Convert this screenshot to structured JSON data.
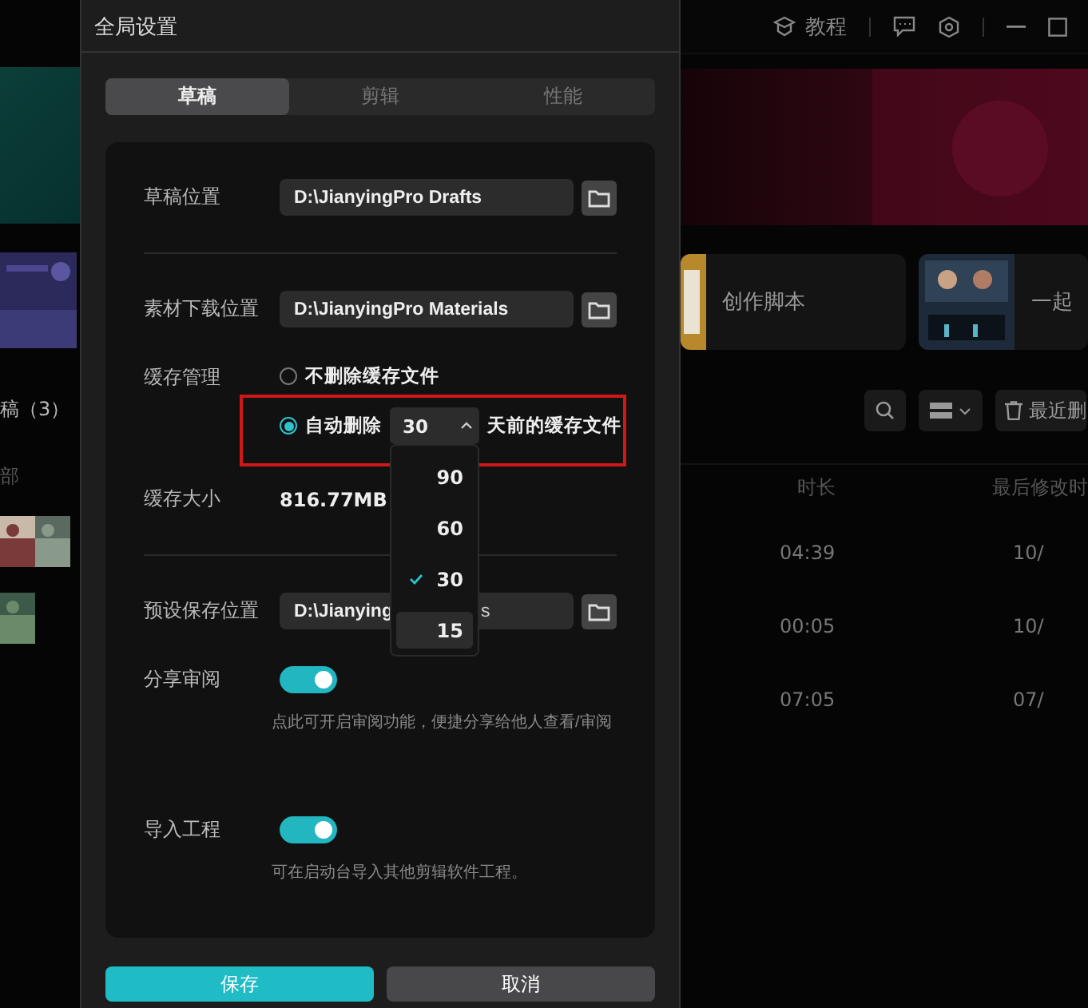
{
  "background_app": {
    "tutorial_label": "教程",
    "cards": [
      {
        "title": "创作脚本"
      },
      {
        "title": "一起"
      }
    ],
    "drafts_title": "稿（3）",
    "recent_deleted": "最近删",
    "columns": [
      "部",
      "时长",
      "最后修改时"
    ],
    "rows": [
      {
        "duration": "04:39",
        "modified": "10/"
      },
      {
        "duration": "00:05",
        "modified": "10/"
      },
      {
        "duration": "07:05",
        "modified": "07/"
      }
    ]
  },
  "dialog": {
    "title": "全局设置",
    "tabs": [
      {
        "label": "草稿",
        "selected": true
      },
      {
        "label": "剪辑",
        "selected": false
      },
      {
        "label": "性能",
        "selected": false
      }
    ],
    "draft_location": {
      "label": "草稿位置",
      "value": "D:\\JianyingPro Drafts"
    },
    "material_location": {
      "label": "素材下载位置",
      "value": "D:\\JianyingPro Materials"
    },
    "cache": {
      "label": "缓存管理",
      "options": [
        {
          "kind": "keep",
          "label": "不删除缓存文件",
          "selected": false
        },
        {
          "kind": "auto",
          "label_before": "自动删除",
          "days": "30",
          "label_after": "天前的缓存文件",
          "selected": true
        }
      ],
      "days_menu": [
        {
          "label": "90",
          "checked": false,
          "hovered": false
        },
        {
          "label": "60",
          "checked": false,
          "hovered": false
        },
        {
          "label": "30",
          "checked": true,
          "hovered": false
        },
        {
          "label": "15",
          "checked": false,
          "hovered": true
        }
      ]
    },
    "cache_size": {
      "label": "缓存大小",
      "value": "816.77MB"
    },
    "preset_location": {
      "label": "预设保存位置",
      "value_start": "D:\\Jianying",
      "value_end": "s"
    },
    "share_review": {
      "label": "分享审阅",
      "on": true,
      "description": "点此可开启审阅功能，便捷分享给他人查看/审阅"
    },
    "import_project": {
      "label": "导入工程",
      "on": true,
      "description": "可在启动台导入其他剪辑软件工程。"
    },
    "buttons": [
      {
        "label": "保存",
        "kind": "primary"
      },
      {
        "label": "取消",
        "kind": "secondary"
      }
    ]
  }
}
